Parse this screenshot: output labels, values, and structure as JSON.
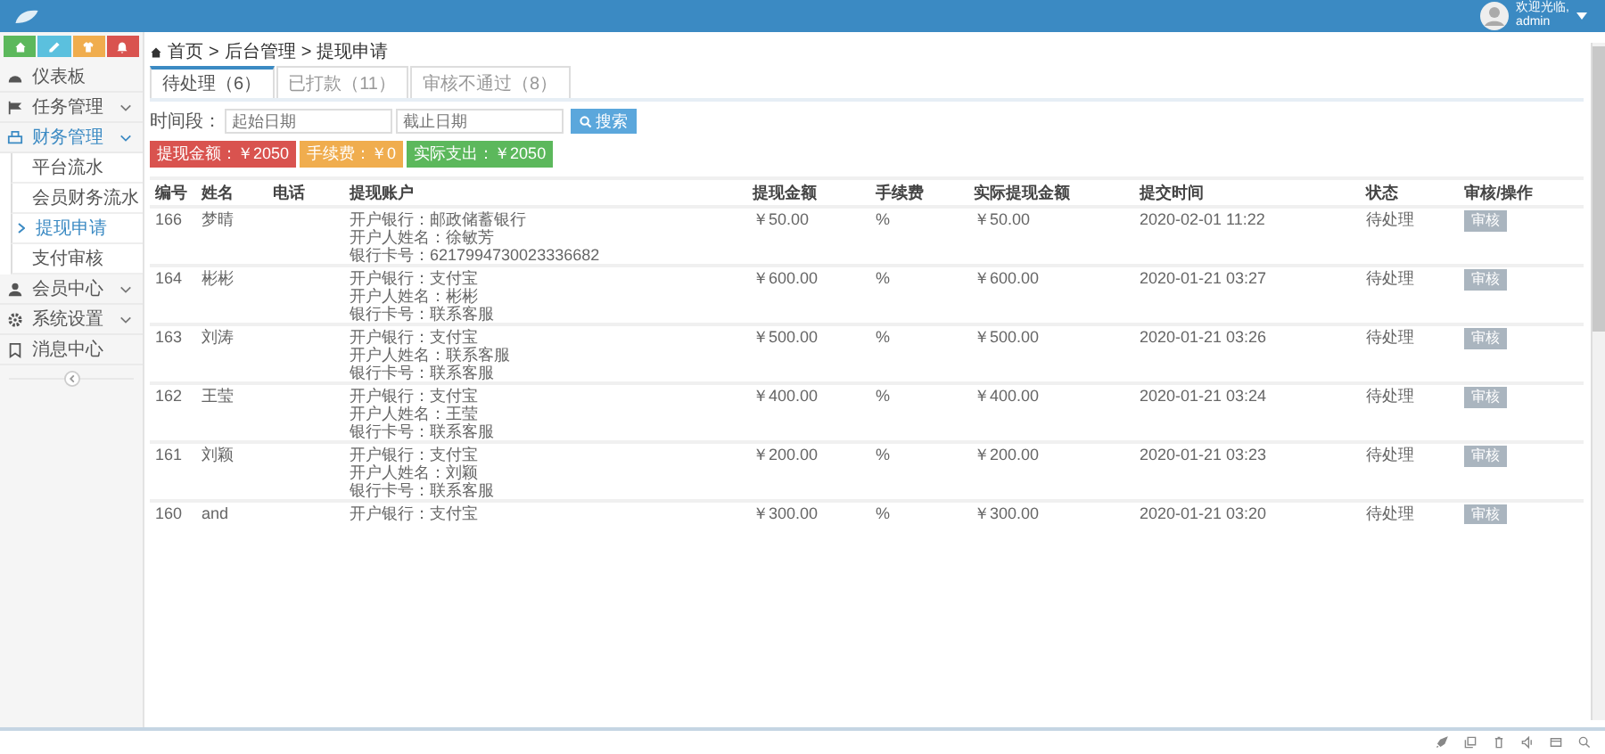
{
  "header": {
    "welcome": "欢迎光临,",
    "user": "admin"
  },
  "sidebar": {
    "items": [
      {
        "label": "仪表板",
        "selected": false
      },
      {
        "label": "任务管理",
        "selected": false,
        "expanded": false
      },
      {
        "label": "财务管理",
        "selected": true,
        "expanded": true,
        "children": [
          {
            "label": "平台流水",
            "selected": false
          },
          {
            "label": "会员财务流水",
            "selected": false
          },
          {
            "label": "提现申请",
            "selected": true
          },
          {
            "label": "支付审核",
            "selected": false
          }
        ]
      },
      {
        "label": "会员中心",
        "selected": false,
        "expanded": false
      },
      {
        "label": "系统设置",
        "selected": false,
        "expanded": false
      },
      {
        "label": "消息中心",
        "selected": false
      }
    ]
  },
  "breadcrumb": {
    "separator": ">",
    "items": [
      "首页",
      "后台管理",
      "提现申请"
    ]
  },
  "tabs": [
    {
      "label": "待处理（6）",
      "selected": true
    },
    {
      "label": "已打款（11）",
      "selected": false
    },
    {
      "label": "审核不通过（8）",
      "selected": false
    }
  ],
  "filter": {
    "label": "时间段：",
    "start_placeholder": "起始日期",
    "end_placeholder": "截止日期",
    "button": "搜索"
  },
  "summary": [
    {
      "text": "提现金额：￥2050",
      "color": "#d9534f"
    },
    {
      "text": "手续费：￥0",
      "color": "#f0ad4e"
    },
    {
      "text": "实际支出：￥2050",
      "color": "#5cb85c"
    }
  ],
  "table": {
    "columns": [
      "编号",
      "姓名",
      "电话",
      "提现账户",
      "提现金额",
      "手续费",
      "实际提现金额",
      "提交时间",
      "状态",
      "审核/操作"
    ],
    "rows": [
      {
        "id": "166",
        "name": "梦晴",
        "account": [
          "开户银行：邮政储蓄银行",
          "开户人姓名：徐敏芳",
          "银行卡号：6217994730023336682"
        ],
        "amount": "￥50.00",
        "fee": "%",
        "actual": "￥50.00",
        "time": "2020-02-01 11:22",
        "status": "待处理",
        "action": "审核"
      },
      {
        "id": "164",
        "name": "彬彬",
        "account": [
          "开户银行：支付宝",
          "开户人姓名：彬彬",
          "银行卡号：联系客服"
        ],
        "amount": "￥600.00",
        "fee": "%",
        "actual": "￥600.00",
        "time": "2020-01-21 03:27",
        "status": "待处理",
        "action": "审核"
      },
      {
        "id": "163",
        "name": "刘涛",
        "account": [
          "开户银行：支付宝",
          "开户人姓名：联系客服",
          "银行卡号：联系客服"
        ],
        "amount": "￥500.00",
        "fee": "%",
        "actual": "￥500.00",
        "time": "2020-01-21 03:26",
        "status": "待处理",
        "action": "审核"
      },
      {
        "id": "162",
        "name": "王莹",
        "account": [
          "开户银行：支付宝",
          "开户人姓名：王莹",
          "银行卡号：联系客服"
        ],
        "amount": "￥400.00",
        "fee": "%",
        "actual": "￥400.00",
        "time": "2020-01-21 03:24",
        "status": "待处理",
        "action": "审核"
      },
      {
        "id": "161",
        "name": "刘颖",
        "account": [
          "开户银行：支付宝",
          "开户人姓名：刘颖",
          "银行卡号：联系客服"
        ],
        "amount": "￥200.00",
        "fee": "%",
        "actual": "￥200.00",
        "time": "2020-01-21 03:23",
        "status": "待处理",
        "action": "审核"
      },
      {
        "id": "160",
        "name": "and",
        "account": [
          "开户银行：支付宝"
        ],
        "amount": "￥300.00",
        "fee": "%",
        "actual": "￥300.00",
        "time": "2020-01-21 03:20",
        "status": "待处理",
        "action": "审核"
      }
    ]
  }
}
